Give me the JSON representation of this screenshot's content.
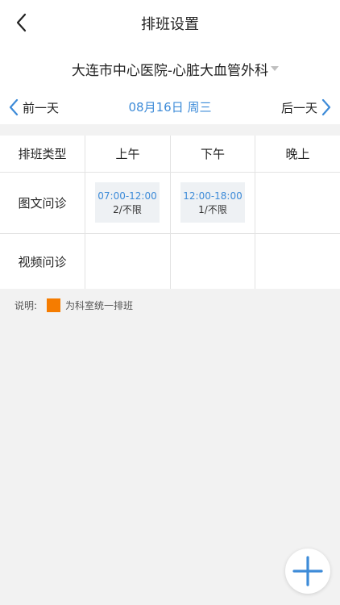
{
  "header": {
    "title": "排班设置"
  },
  "hospital": {
    "name": "大连市中心医院-心脏大血管外科"
  },
  "date_nav": {
    "prev_label": "前一天",
    "current_date": "08月16日 周三",
    "next_label": "后一天"
  },
  "table": {
    "columns": [
      "排班类型",
      "上午",
      "下午",
      "晚上"
    ],
    "rows": [
      {
        "type": "图文问诊",
        "slots": [
          {
            "time": "07:00-12:00",
            "capacity": "2/不限"
          },
          {
            "time": "12:00-18:00",
            "capacity": "1/不限"
          }
        ]
      },
      {
        "type": "视频问诊"
      }
    ]
  },
  "note": {
    "prefix": "说明:",
    "text": "为科室统一排班",
    "swatch_color": "#f57c00"
  },
  "colors": {
    "accent": "#3d8bd8"
  },
  "icons": {
    "back": "chevron-left-icon",
    "prev": "chevron-left-icon",
    "next": "chevron-right-icon",
    "fab": "plus-icon",
    "dropdown": "caret-down-icon"
  }
}
